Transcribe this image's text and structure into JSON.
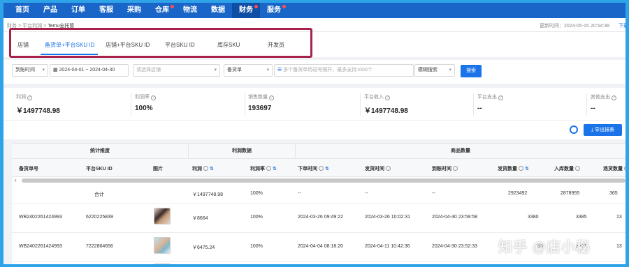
{
  "nav": {
    "items": [
      {
        "label": "首页",
        "dot": false,
        "active": false
      },
      {
        "label": "产品",
        "dot": false,
        "active": false
      },
      {
        "label": "订单",
        "dot": false,
        "active": false
      },
      {
        "label": "客服",
        "dot": false,
        "active": false
      },
      {
        "label": "采购",
        "dot": false,
        "active": false
      },
      {
        "label": "仓库",
        "dot": true,
        "active": false
      },
      {
        "label": "物流",
        "dot": false,
        "active": false
      },
      {
        "label": "数据",
        "dot": false,
        "active": false
      },
      {
        "label": "财务",
        "dot": true,
        "active": true
      },
      {
        "label": "服务",
        "dot": true,
        "active": false
      }
    ]
  },
  "breadcrumb": {
    "items": [
      "财务",
      "平台利润",
      "Temu全托管"
    ],
    "separator": ">"
  },
  "header": {
    "updated": "更新时间：2024-05-15 20:54:38",
    "download": "下载"
  },
  "tabs": [
    {
      "label": "店铺",
      "active": false
    },
    {
      "label": "备货单+平台SKU ID",
      "active": true
    },
    {
      "label": "店铺+平台SKU ID",
      "active": false
    },
    {
      "label": "平台SKU ID",
      "active": false
    },
    {
      "label": "库存SKU",
      "active": false
    },
    {
      "label": "开发员",
      "active": false
    }
  ],
  "filters": {
    "time_type": "到账时间",
    "date_range": "2024-04-01 ~ 2024-04-30",
    "shop_placeholder": "请选择店铺",
    "order_type": "备货单",
    "search_placeholder": "多个备货单用逗号隔开，最多支持1000个",
    "match_mode": "模糊搜索",
    "search_button": "搜索"
  },
  "stats": [
    {
      "label": "利润",
      "value": "￥1497748.98"
    },
    {
      "label": "利润率",
      "value": "100%"
    },
    {
      "label": "销售数量",
      "value": "193697"
    },
    {
      "label": "平台收入",
      "value": "￥1497748.98"
    },
    {
      "label": "平台支出",
      "value": "--"
    },
    {
      "label": "其他支出",
      "value": "--"
    }
  ],
  "toolbar": {
    "export": "导出报表"
  },
  "table": {
    "groups": [
      "统计维度",
      "利润数据",
      "商品数量"
    ],
    "columns": [
      "备货单号",
      "平台SKU ID",
      "图片",
      "利润",
      "利润率",
      "下单时间",
      "发货时间",
      "到账时间",
      "发货数量",
      "入库数量",
      "退货数量"
    ],
    "total_row": {
      "label": "合计",
      "profit": "￥1497748.98",
      "margin": "100%",
      "order_time": "--",
      "ship_time": "--",
      "arrive_time": "--",
      "ship_qty": "2923492",
      "stock_qty": "2878955",
      "return_qty": "365"
    },
    "rows": [
      {
        "order_no": "WB2402261424993",
        "sku": "6220225839",
        "profit": "￥8664",
        "margin": "100%",
        "order_time": "2024-03-26 09:49:22",
        "ship_time": "2024-03-26 10:02:31",
        "arrive_time": "2024-04-30 23:59:58",
        "ship_qty": "3380",
        "stock_qty": "3385",
        "return_qty": "13"
      },
      {
        "order_no": "WB2402261424993",
        "sku": "7222864656",
        "profit": "￥6475.24",
        "margin": "100%",
        "order_time": "2024-04-04 08:18:20",
        "ship_time": "2024-04-11 10:42:36",
        "arrive_time": "2024-04-30 23:52:33",
        "ship_qty": "53",
        "stock_qty": "3483",
        "return_qty": "13"
      }
    ]
  },
  "watermark": "知乎 @店小秘"
}
